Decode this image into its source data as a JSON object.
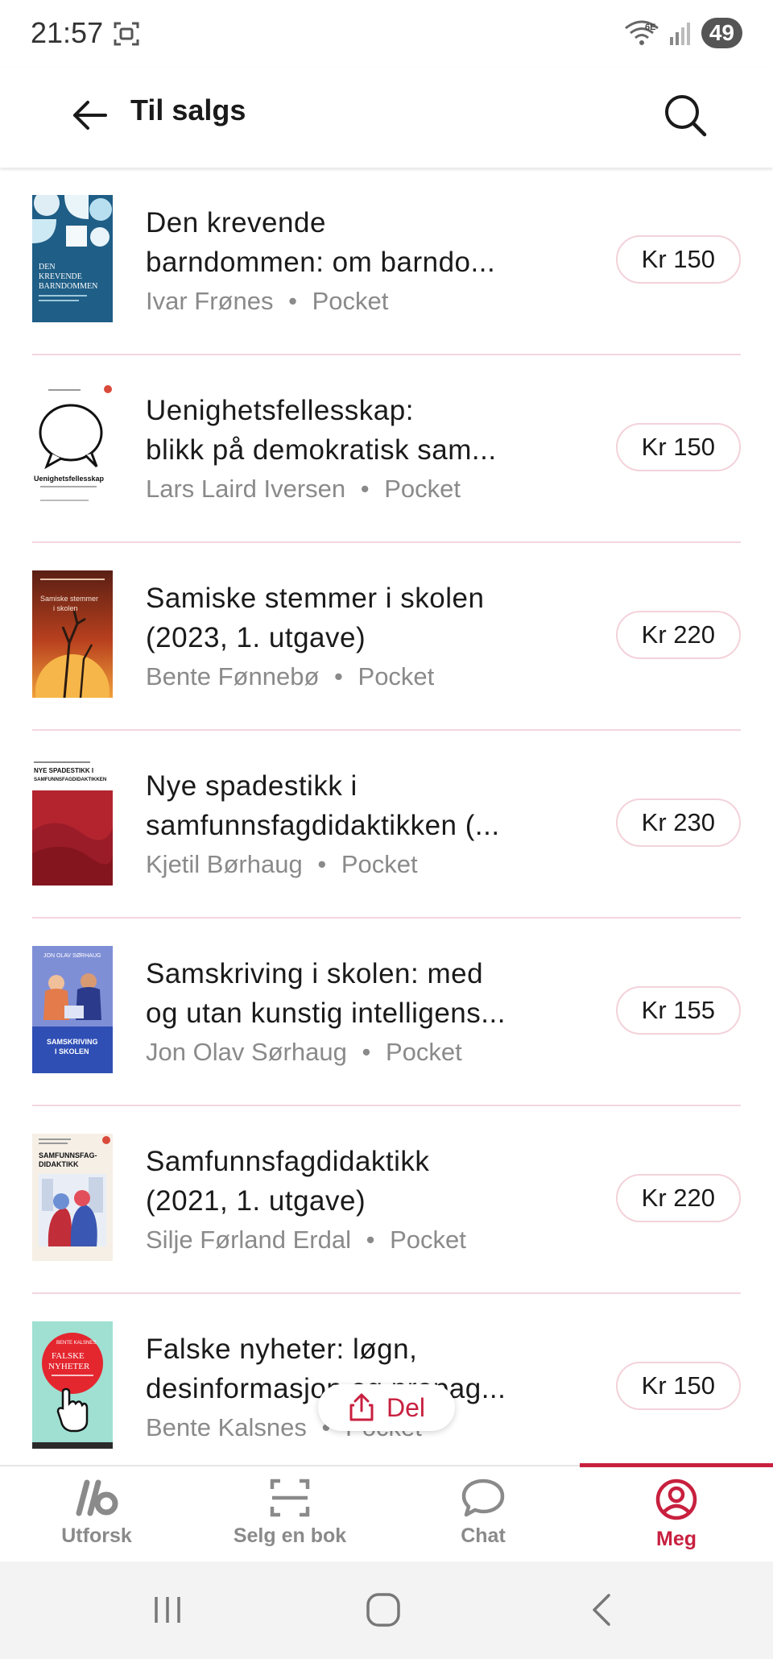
{
  "status_bar": {
    "time": "21:57",
    "network_label": "6E",
    "battery": "49"
  },
  "app_bar": {
    "title": "Til salgs",
    "back_icon": "arrow-left-icon",
    "search_icon": "search-icon"
  },
  "books": [
    {
      "title_line1": "Den krevende",
      "title_line2": "barndommen: om barndo...",
      "author": "Ivar Frønes",
      "format": "Pocket",
      "separator": "•",
      "price": "Kr 150",
      "cover_text": [
        "DEN",
        "KREVENDE",
        "BARNDOMMEN"
      ]
    },
    {
      "title_line1": "Uenighetsfellesskap:",
      "title_line2": "blikk på demokratisk sam...",
      "author": "Lars Laird Iversen",
      "format": "Pocket",
      "separator": "•",
      "price": "Kr 150",
      "cover_text": [
        "Uenighetsfellesskap"
      ]
    },
    {
      "title_line1": "Samiske stemmer i skolen",
      "title_line2": "(2023, 1. utgave)",
      "author": "Bente Fønnebø",
      "format": "Pocket",
      "separator": "•",
      "price": "Kr 220",
      "cover_text": [
        "Samiske stemmer",
        "i skolen"
      ]
    },
    {
      "title_line1": "Nye spadestikk i",
      "title_line2": "samfunnsfagdidaktikken (...",
      "author": "Kjetil Børhaug",
      "format": "Pocket",
      "separator": "•",
      "price": "Kr 230",
      "cover_text": [
        "NYE SPADESTIKK I",
        "SAMFUNNSFAGDIDAKTIKKEN"
      ]
    },
    {
      "title_line1": "Samskriving i skolen: med",
      "title_line2": "og utan kunstig intelligens...",
      "author": "Jon Olav Sørhaug",
      "format": "Pocket",
      "separator": "•",
      "price": "Kr 155",
      "cover_text": [
        "JON OLAV SØRHAUG",
        "SAMSKRIVING",
        "I SKOLEN"
      ]
    },
    {
      "title_line1": "Samfunnsfagdidaktikk",
      "title_line2": "(2021, 1. utgave)",
      "author": "Silje Førland Erdal",
      "format": "Pocket",
      "separator": "•",
      "price": "Kr 220",
      "cover_text": [
        "SAMFUNNSFAG-",
        "DIDAKTIKK"
      ]
    },
    {
      "title_line1": "Falske nyheter: løgn,",
      "title_line2": "desinformasjon og propag...",
      "author": "Bente Kalsnes",
      "format": "Pocket",
      "separator": "•",
      "price": "Kr 150",
      "cover_text": [
        "FALSKE",
        "NYHETER"
      ]
    }
  ],
  "share_button": {
    "label": "Del",
    "icon": "share-icon"
  },
  "bottom_nav": {
    "items": [
      {
        "label": "Utforsk",
        "icon": "ib-logo-icon"
      },
      {
        "label": "Selg en bok",
        "icon": "scan-icon"
      },
      {
        "label": "Chat",
        "icon": "chat-bubble-icon"
      },
      {
        "label": "Meg",
        "icon": "profile-icon",
        "active": true
      }
    ]
  },
  "colors": {
    "accent": "#c8203f",
    "divider": "#f4d6df",
    "price_border": "#f3d2da",
    "muted_text": "#8a8a8a"
  }
}
